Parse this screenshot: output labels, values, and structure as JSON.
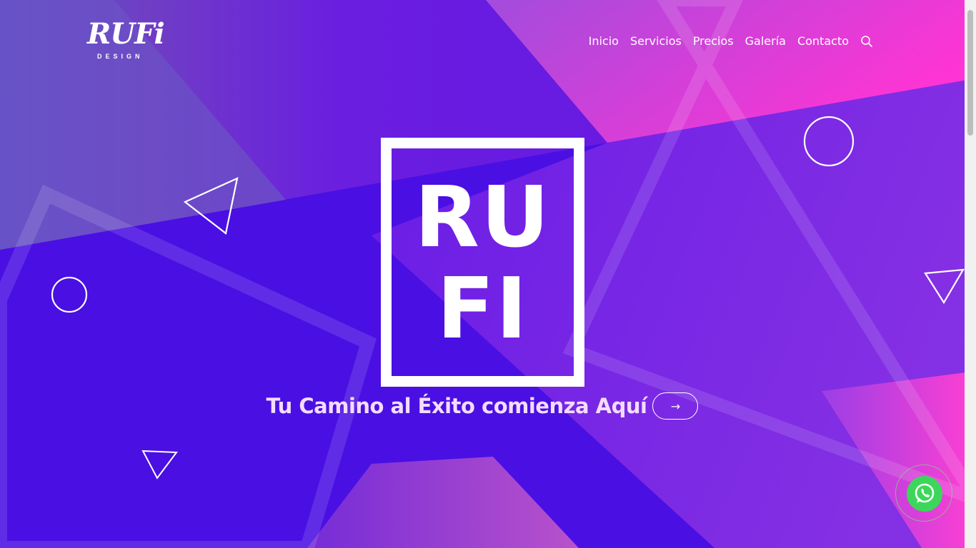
{
  "logo": {
    "main": "RUFi",
    "sub": "DESIGN"
  },
  "nav": {
    "items": [
      "Inicio",
      "Servicios",
      "Precios",
      "Galería",
      "Contacto"
    ],
    "search_icon": "search-icon"
  },
  "hero": {
    "line1": "RU",
    "line2": "FI",
    "tagline": "Tu Camino al Éxito comienza Aquí",
    "arrow": "→"
  },
  "whatsapp": {
    "icon": "whatsapp-icon",
    "color": "#3cd75a"
  },
  "colors": {
    "background": "#4d12e6",
    "accent_pink": "#ff3fd0",
    "text": "#ffffff"
  }
}
